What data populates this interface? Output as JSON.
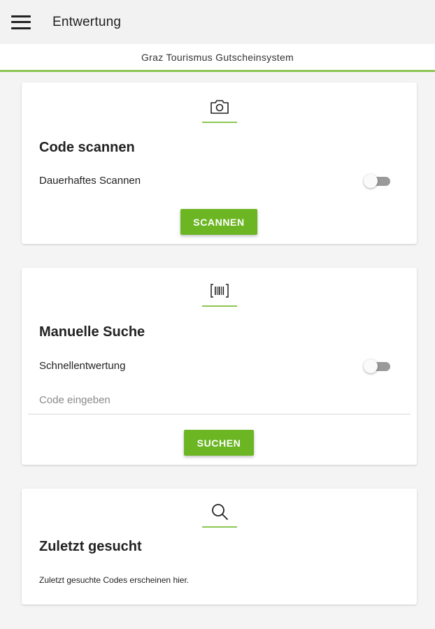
{
  "appbar": {
    "title": "Entwertung",
    "menu_icon": "hamburger-menu-icon"
  },
  "subheader": {
    "text": "Graz Tourismus Gutscheinsystem"
  },
  "scan_card": {
    "icon": "camera-icon",
    "title": "Code scannen",
    "toggle_label": "Dauerhaftes Scannen",
    "toggle_on": false,
    "button_label": "SCANNEN"
  },
  "search_card": {
    "icon": "barcode-icon",
    "title": "Manuelle Suche",
    "toggle_label": "Schnellentwertung",
    "toggle_on": false,
    "input_placeholder": "Code eingeben",
    "input_value": "",
    "button_label": "SUCHEN"
  },
  "recent_card": {
    "icon": "search-icon",
    "title": "Zuletzt gesucht",
    "hint": "Zuletzt gesuchte Codes erscheinen hier."
  },
  "colors": {
    "accent": "#6cb624",
    "accent_line": "#8cc653",
    "background": "#f4f4f4",
    "card": "#ffffff",
    "toggle_off_track": "#9a9a9a"
  }
}
